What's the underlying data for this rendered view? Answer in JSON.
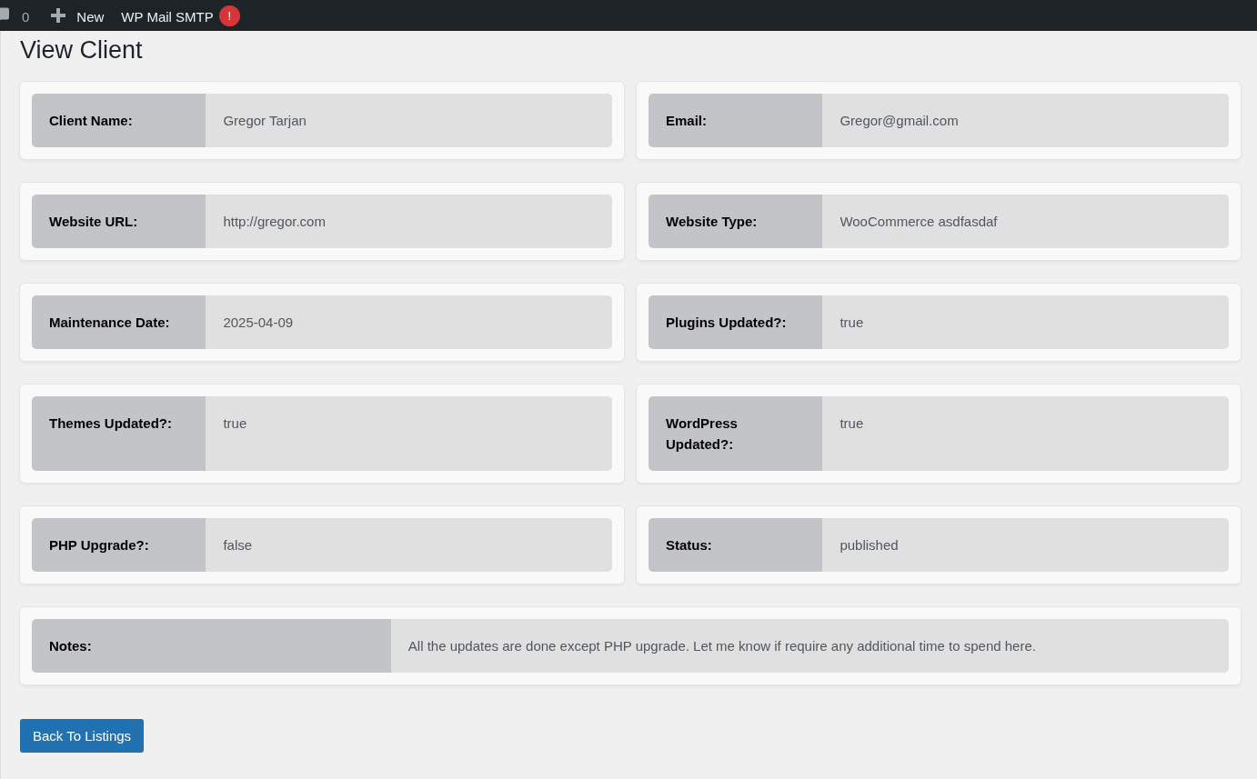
{
  "admin_bar": {
    "items": [
      {
        "kind": "comments",
        "label": "0"
      },
      {
        "kind": "new",
        "label": "New"
      },
      {
        "kind": "plugin",
        "label": "WP Mail SMTP",
        "badge": "!"
      }
    ]
  },
  "page": {
    "title": "View Client"
  },
  "fields": [
    {
      "label": "Client Name:",
      "value": "Gregor Tarjan"
    },
    {
      "label": "Email:",
      "value": "Gregor@gmail.com"
    },
    {
      "label": "Website URL:",
      "value": "http://gregor.com"
    },
    {
      "label": "Website Type:",
      "value": "WooCommerce asdfasdaf"
    },
    {
      "label": "Maintenance Date:",
      "value": "2025-04-09"
    },
    {
      "label": "Plugins Updated?:",
      "value": "true"
    },
    {
      "label": "Themes Updated?:",
      "value": "true"
    },
    {
      "label": "WordPress Updated?:",
      "value": "true"
    },
    {
      "label": "PHP Upgrade?:",
      "value": "false"
    },
    {
      "label": "Status:",
      "value": "published"
    }
  ],
  "notes": {
    "label": "Notes:",
    "value": "All the updates are done except PHP upgrade. Let me know if require any additional time to spend here."
  },
  "back_button": {
    "label": "Back To Listings"
  }
}
